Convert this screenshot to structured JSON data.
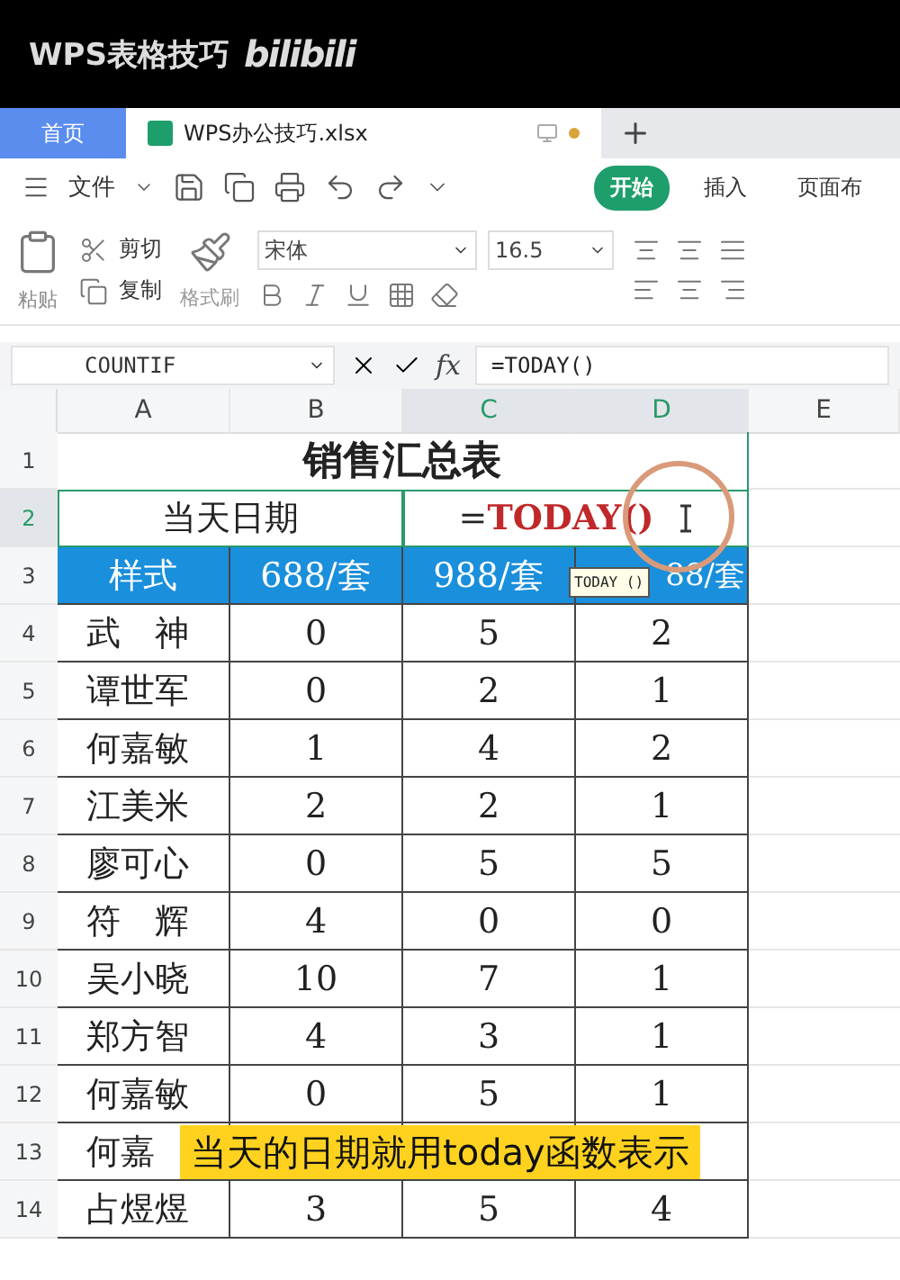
{
  "video_header": {
    "title": "WPS表格技巧",
    "logo": "bilibili"
  },
  "tabs": [
    {
      "label": "首页",
      "kind": "home",
      "selected": false
    },
    {
      "label": "WPS办公技巧.xlsx",
      "kind": "document",
      "selected": true
    }
  ],
  "file_menu": "文件",
  "ribbon_tabs": [
    {
      "label": "开始",
      "selected": true
    },
    {
      "label": "插入",
      "selected": false
    },
    {
      "label": "页面布",
      "selected": false
    }
  ],
  "clipboard": {
    "paste": "粘贴",
    "cut": "剪切",
    "copy": "复制",
    "format_painter": "格式刷"
  },
  "font": {
    "name": "宋体",
    "size": "16.5"
  },
  "formula_bar": {
    "name_box": "COUNTIF",
    "fx_label": "fx",
    "formula": "=TODAY()"
  },
  "columns": [
    {
      "label": "A",
      "selected": false
    },
    {
      "label": "B",
      "selected": false
    },
    {
      "label": "C",
      "selected": true
    },
    {
      "label": "D",
      "selected": true
    },
    {
      "label": "E",
      "selected": false
    }
  ],
  "rows": [
    {
      "number": "1",
      "kind": "title",
      "selected": false,
      "cells": [
        "销售汇总表"
      ]
    },
    {
      "number": "2",
      "kind": "date",
      "selected": true,
      "cells": [
        "当天日期"
      ],
      "formula_parts": [
        {
          "text": "=",
          "kind": "plain"
        },
        {
          "text": "TODAY()",
          "kind": "function"
        }
      ],
      "tooltip": "TODAY ()"
    },
    {
      "number": "3",
      "kind": "header",
      "selected": false,
      "cells": [
        "样式",
        "688/套",
        "988/套",
        "88/套"
      ]
    },
    {
      "number": "4",
      "kind": "data",
      "selected": false,
      "cells": [
        "武　神",
        "0",
        "5",
        "2"
      ]
    },
    {
      "number": "5",
      "kind": "data",
      "selected": false,
      "cells": [
        "谭世军",
        "0",
        "2",
        "1"
      ]
    },
    {
      "number": "6",
      "kind": "data",
      "selected": false,
      "cells": [
        "何嘉敏",
        "1",
        "4",
        "2"
      ]
    },
    {
      "number": "7",
      "kind": "data",
      "selected": false,
      "cells": [
        "江美米",
        "2",
        "2",
        "1"
      ]
    },
    {
      "number": "8",
      "kind": "data",
      "selected": false,
      "cells": [
        "廖可心",
        "0",
        "5",
        "5"
      ]
    },
    {
      "number": "9",
      "kind": "data",
      "selected": false,
      "cells": [
        "符　辉",
        "4",
        "0",
        "0"
      ]
    },
    {
      "number": "10",
      "kind": "data",
      "selected": false,
      "cells": [
        "吴小晓",
        "10",
        "7",
        "1"
      ]
    },
    {
      "number": "11",
      "kind": "data",
      "selected": false,
      "cells": [
        "郑方智",
        "4",
        "3",
        "1"
      ]
    },
    {
      "number": "12",
      "kind": "data",
      "selected": false,
      "cells": [
        "何嘉敏",
        "0",
        "5",
        "1"
      ]
    },
    {
      "number": "13",
      "kind": "data",
      "selected": false,
      "cells": [
        "何嘉",
        "",
        "",
        ""
      ]
    },
    {
      "number": "14",
      "kind": "data",
      "selected": false,
      "cells": [
        "占煜煜",
        "3",
        "5",
        "4"
      ]
    }
  ],
  "caption": "当天的日期就用today函数表示"
}
